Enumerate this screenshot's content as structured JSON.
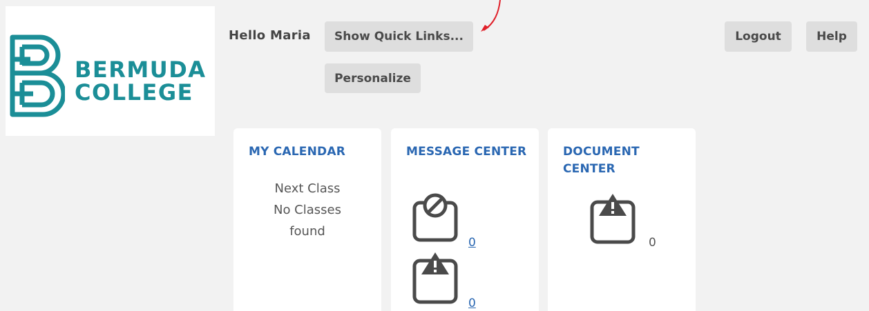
{
  "brand": {
    "line1": "BERMUDA",
    "line2": "COLLEGE",
    "color": "#1b8e97"
  },
  "header": {
    "greeting": "Hello Maria",
    "quick_links_label": "Show Quick Links...",
    "personalize_label": "Personalize",
    "logout_label": "Logout",
    "help_label": "Help"
  },
  "cards": {
    "calendar": {
      "title": "MY CALENDAR",
      "line1": "Next Class",
      "line2": "No Classes",
      "line3": "found"
    },
    "message": {
      "title": "MESSAGE CENTER",
      "blocked_icon": "blocked-messages-icon",
      "blocked_count": "0",
      "alert_icon": "alert-messages-icon",
      "alert_count": "0"
    },
    "document": {
      "title": "DOCUMENT CENTER",
      "alert_icon": "alert-documents-icon",
      "count": "0"
    }
  },
  "colors": {
    "accent": "#2a67b2",
    "button_bg": "#dedede",
    "page_bg": "#f2f2f2",
    "annotation": "#e0202a"
  }
}
